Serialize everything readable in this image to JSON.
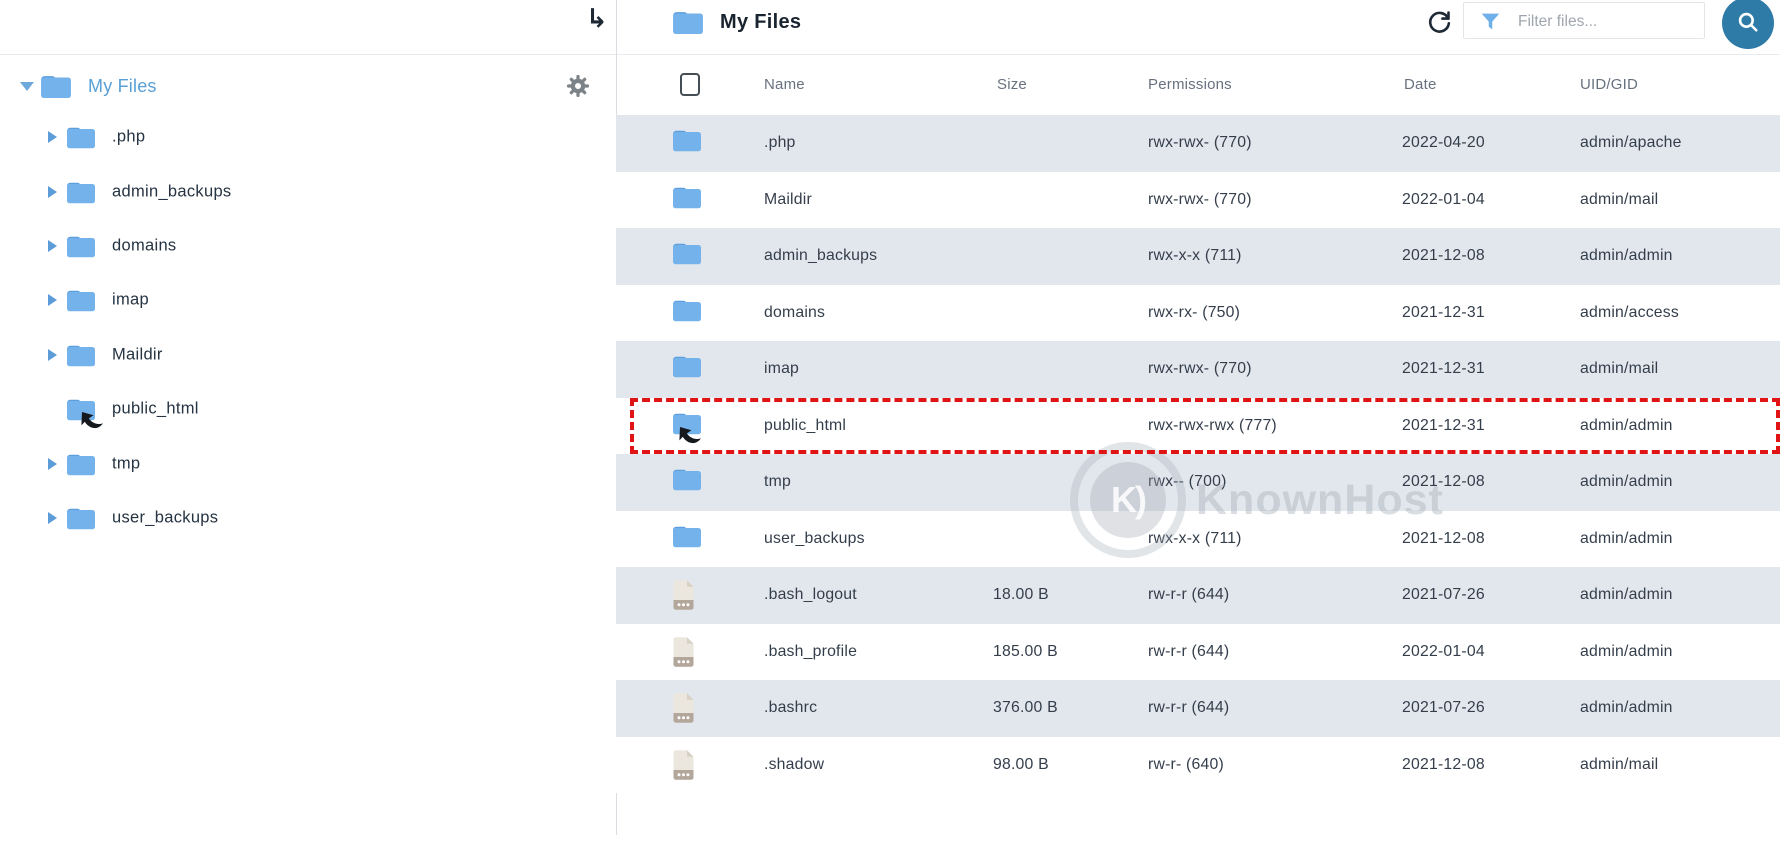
{
  "sidebar": {
    "go_icon": "↳",
    "root_label": "My Files",
    "items": [
      {
        "label": ".php",
        "expandable": true,
        "cursor": false
      },
      {
        "label": "admin_backups",
        "expandable": true,
        "cursor": false
      },
      {
        "label": "domains",
        "expandable": true,
        "cursor": false
      },
      {
        "label": "imap",
        "expandable": true,
        "cursor": false
      },
      {
        "label": "Maildir",
        "expandable": true,
        "cursor": false
      },
      {
        "label": "public_html",
        "expandable": false,
        "cursor": true
      },
      {
        "label": "tmp",
        "expandable": true,
        "cursor": false
      },
      {
        "label": "user_backups",
        "expandable": true,
        "cursor": false
      }
    ]
  },
  "toolbar": {
    "title": "My Files",
    "filter_placeholder": "Filter files..."
  },
  "table": {
    "headers": [
      "Name",
      "Size",
      "Permissions",
      "Date",
      "UID/GID"
    ],
    "rows": [
      {
        "icon": "folder",
        "name": ".php",
        "size": "",
        "permissions": "rwx-rwx- (770)",
        "date": "2022-04-20",
        "uid_gid": "admin/apache",
        "highlighted": false
      },
      {
        "icon": "folder",
        "name": "Maildir",
        "size": "",
        "permissions": "rwx-rwx- (770)",
        "date": "2022-01-04",
        "uid_gid": "admin/mail",
        "highlighted": false
      },
      {
        "icon": "folder",
        "name": "admin_backups",
        "size": "",
        "permissions": "rwx-x-x (711)",
        "date": "2021-12-08",
        "uid_gid": "admin/admin",
        "highlighted": false
      },
      {
        "icon": "folder",
        "name": "domains",
        "size": "",
        "permissions": "rwx-rx- (750)",
        "date": "2021-12-31",
        "uid_gid": "admin/access",
        "highlighted": false
      },
      {
        "icon": "folder",
        "name": "imap",
        "size": "",
        "permissions": "rwx-rwx- (770)",
        "date": "2021-12-31",
        "uid_gid": "admin/mail",
        "highlighted": false
      },
      {
        "icon": "folder",
        "name": "public_html",
        "size": "",
        "permissions": "rwx-rwx-rwx (777)",
        "date": "2021-12-31",
        "uid_gid": "admin/admin",
        "highlighted": true,
        "cursor": true
      },
      {
        "icon": "folder",
        "name": "tmp",
        "size": "",
        "permissions": "rwx-- (700)",
        "date": "2021-12-08",
        "uid_gid": "admin/admin",
        "highlighted": false
      },
      {
        "icon": "folder",
        "name": "user_backups",
        "size": "",
        "permissions": "rwx-x-x (711)",
        "date": "2021-12-08",
        "uid_gid": "admin/admin",
        "highlighted": false
      },
      {
        "icon": "file",
        "name": ".bash_logout",
        "size": "18.00 B",
        "permissions": "rw-r-r (644)",
        "date": "2021-07-26",
        "uid_gid": "admin/admin",
        "highlighted": false
      },
      {
        "icon": "file",
        "name": ".bash_profile",
        "size": "185.00 B",
        "permissions": "rw-r-r (644)",
        "date": "2022-01-04",
        "uid_gid": "admin/admin",
        "highlighted": false
      },
      {
        "icon": "file",
        "name": ".bashrc",
        "size": "376.00 B",
        "permissions": "rw-r-r (644)",
        "date": "2021-07-26",
        "uid_gid": "admin/admin",
        "highlighted": false
      },
      {
        "icon": "file",
        "name": ".shadow",
        "size": "98.00 B",
        "permissions": "rw-r- (640)",
        "date": "2021-12-08",
        "uid_gid": "admin/mail",
        "highlighted": false
      }
    ]
  },
  "watermark": {
    "logo_text": "K)",
    "text": "KnownHost"
  },
  "colors": {
    "accent_blue": "#74b2ec",
    "link_blue": "#58a0d6",
    "search_button": "#2e7ba7",
    "stripe": "#e2e7ed",
    "highlight_red": "#e01414"
  }
}
